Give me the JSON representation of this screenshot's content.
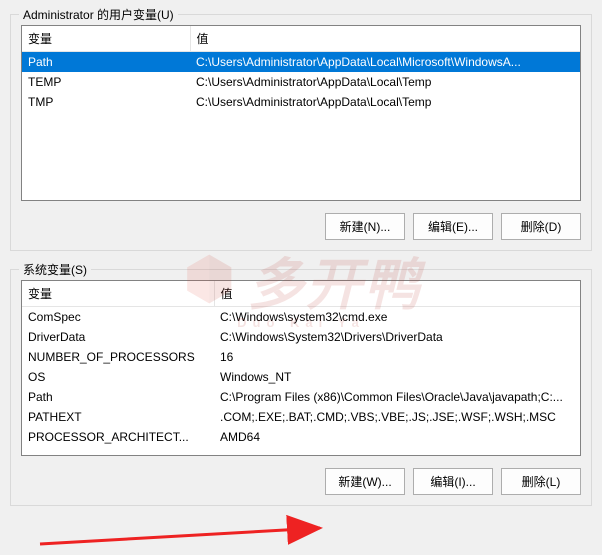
{
  "user_section": {
    "label": "Administrator 的用户变量(U)",
    "columns": {
      "name": "变量",
      "value": "值"
    },
    "rows": [
      {
        "name": "Path",
        "value": "C:\\Users\\Administrator\\AppData\\Local\\Microsoft\\WindowsA...",
        "selected": true
      },
      {
        "name": "TEMP",
        "value": "C:\\Users\\Administrator\\AppData\\Local\\Temp",
        "selected": false
      },
      {
        "name": "TMP",
        "value": "C:\\Users\\Administrator\\AppData\\Local\\Temp",
        "selected": false
      }
    ],
    "buttons": {
      "new": "新建(N)...",
      "edit": "编辑(E)...",
      "delete": "删除(D)"
    }
  },
  "system_section": {
    "label": "系统变量(S)",
    "columns": {
      "name": "变量",
      "value": "值"
    },
    "rows": [
      {
        "name": "ComSpec",
        "value": "C:\\Windows\\system32\\cmd.exe"
      },
      {
        "name": "DriverData",
        "value": "C:\\Windows\\System32\\Drivers\\DriverData"
      },
      {
        "name": "NUMBER_OF_PROCESSORS",
        "value": "16"
      },
      {
        "name": "OS",
        "value": "Windows_NT"
      },
      {
        "name": "Path",
        "value": "C:\\Program Files (x86)\\Common Files\\Oracle\\Java\\javapath;C:..."
      },
      {
        "name": "PATHEXT",
        "value": ".COM;.EXE;.BAT;.CMD;.VBS;.VBE;.JS;.JSE;.WSF;.WSH;.MSC"
      },
      {
        "name": "PROCESSOR_ARCHITECT...",
        "value": "AMD64"
      }
    ],
    "buttons": {
      "new": "新建(W)...",
      "edit": "编辑(I)...",
      "delete": "删除(L)"
    }
  },
  "watermark": {
    "text": "多开鸭",
    "sub": "Duo Kai Ya"
  }
}
